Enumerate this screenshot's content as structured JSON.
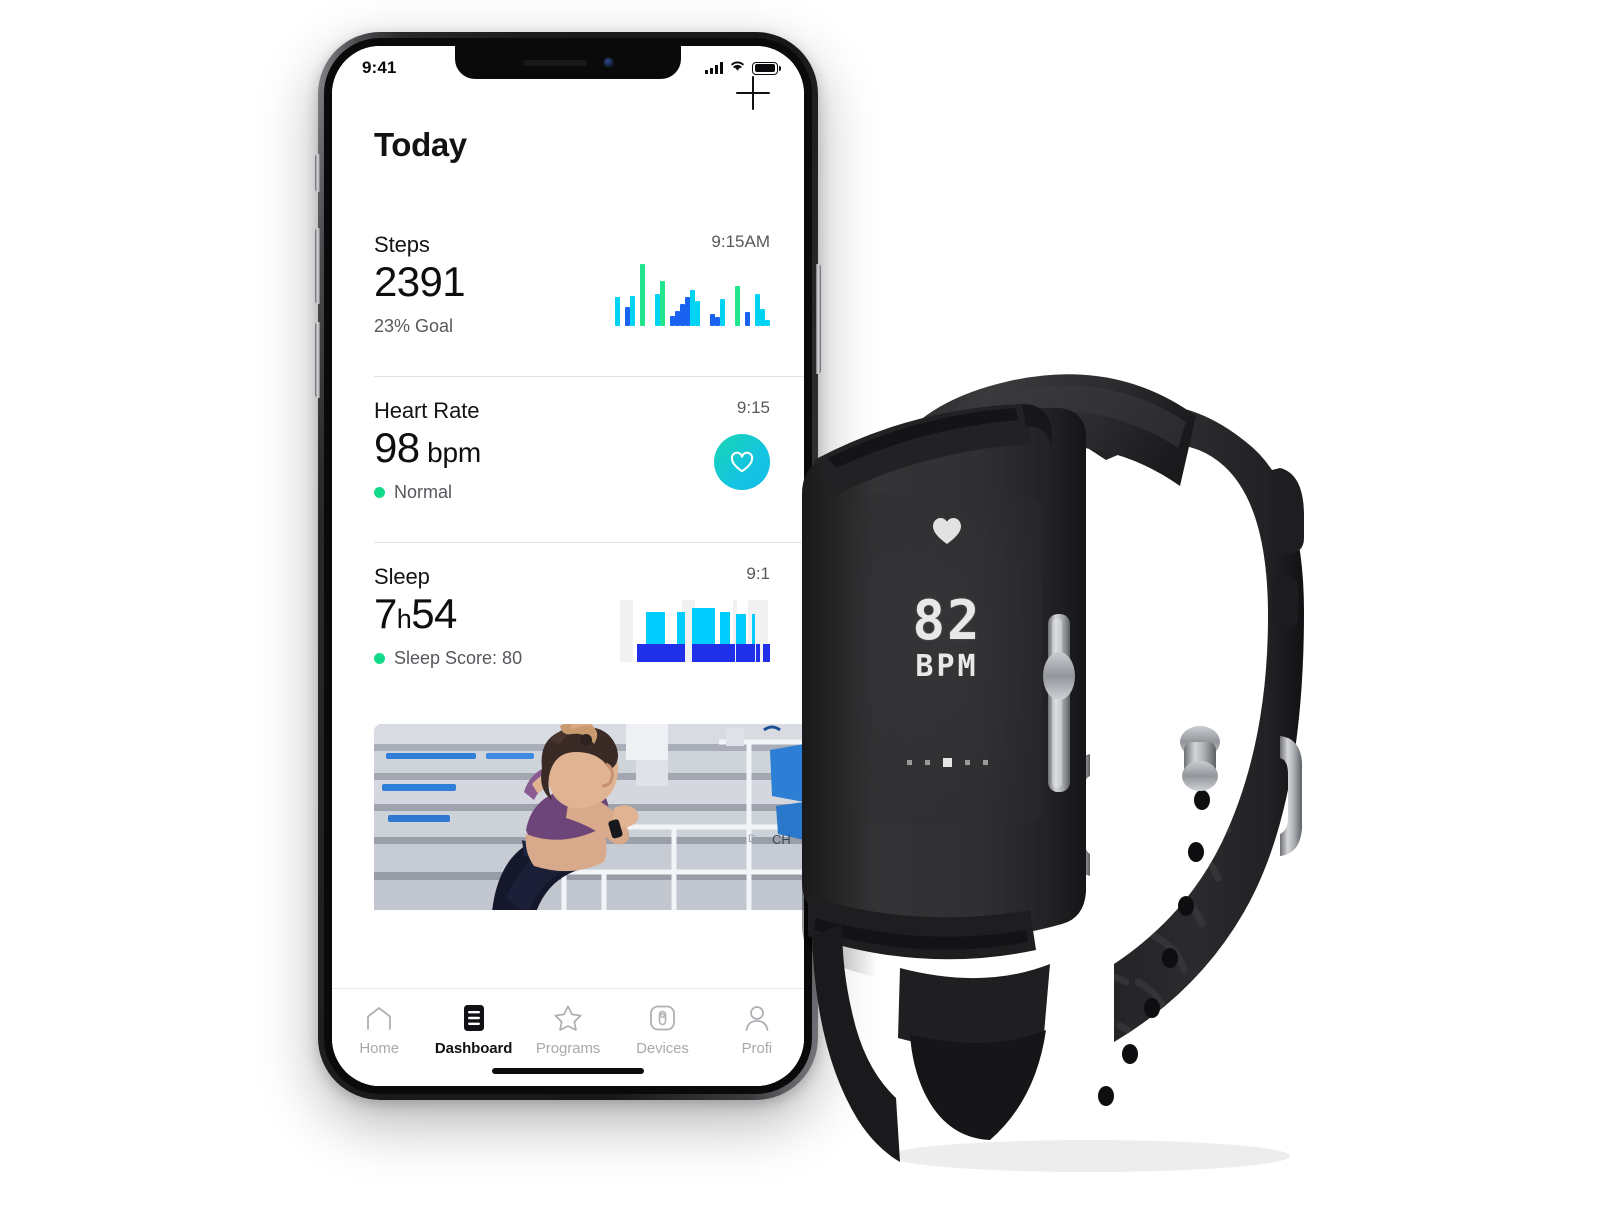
{
  "phone": {
    "status_bar": {
      "time": "9:41",
      "cellular_icon": "signal-bars-icon",
      "wifi_icon": "wifi-icon",
      "battery_icon": "battery-full-icon"
    },
    "app": {
      "add_button": "+",
      "page_title": "Today",
      "rows": [
        {
          "id": "steps",
          "label": "Steps",
          "value": "2391",
          "sub": "23% Goal",
          "time": "9:15AM",
          "has_status_dot": false,
          "visual": "steps-bar-chart"
        },
        {
          "id": "heart-rate",
          "label": "Heart Rate",
          "value": "98",
          "unit": "bpm",
          "sub": "Normal",
          "time": "9:15",
          "has_status_dot": true,
          "visual": "heart-circle-icon"
        },
        {
          "id": "sleep",
          "label": "Sleep",
          "value_hours": "7",
          "value_h_sep": "h",
          "value_minutes": "54",
          "sub": "Sleep Score: 80",
          "time": "9:1",
          "has_status_dot": true,
          "visual": "sleep-bar-chart"
        }
      ],
      "hero_image_alt": "woman stretching on stadium bleachers",
      "tabs": [
        {
          "id": "home",
          "label": "Home",
          "icon": "home-icon",
          "active": false
        },
        {
          "id": "dashboard",
          "label": "Dashboard",
          "icon": "dashboard-icon",
          "active": true
        },
        {
          "id": "programs",
          "label": "Programs",
          "icon": "star-icon",
          "active": false
        },
        {
          "id": "devices",
          "label": "Devices",
          "icon": "watch-icon",
          "active": false
        },
        {
          "id": "profile",
          "label": "Profi",
          "icon": "person-icon",
          "active": false
        }
      ]
    }
  },
  "watch": {
    "heart_icon": "heart-icon",
    "bpm_value": "82",
    "bpm_unit": "BPM",
    "page_dots": 5,
    "page_dot_active_index": 2
  },
  "colors": {
    "steps_green": "#21e58c",
    "steps_cyan": "#00d4f5",
    "steps_blue": "#1a62f0",
    "sleep_cyan": "#00ccff",
    "sleep_blue": "#2030e8",
    "sleep_track": "#f1f1f2",
    "status_green": "#13d98a",
    "hr_gradient_start": "#18d6b0",
    "hr_gradient_end": "#13bbe8",
    "text_primary": "#111214",
    "text_secondary": "#55585c",
    "tab_inactive": "#a7a9ad"
  },
  "chart_data": [
    {
      "type": "bar",
      "id": "steps-bar-chart",
      "title": "Steps",
      "xlabel": "",
      "ylabel": "",
      "grid": false,
      "legend": "none",
      "ylim": [
        0,
        100
      ],
      "colors": [
        "#00d4f5",
        "#1a62f0",
        "#21e58c"
      ],
      "bars": [
        {
          "h": 46,
          "c": "#00d4f5"
        },
        {
          "h": 0,
          "c": "none"
        },
        {
          "h": 30,
          "c": "#1a62f0"
        },
        {
          "h": 48,
          "c": "#00d4f5"
        },
        {
          "h": 0,
          "c": "none"
        },
        {
          "h": 100,
          "c": "#21e58c"
        },
        {
          "h": 0,
          "c": "none"
        },
        {
          "h": 0,
          "c": "none"
        },
        {
          "h": 52,
          "c": "#00d4f5"
        },
        {
          "h": 73,
          "c": "#21e58c"
        },
        {
          "h": 0,
          "c": "none"
        },
        {
          "h": 16,
          "c": "#1a62f0"
        },
        {
          "h": 24,
          "c": "#1a62f0"
        },
        {
          "h": 36,
          "c": "#1a62f0"
        },
        {
          "h": 46,
          "c": "#1a62f0"
        },
        {
          "h": 58,
          "c": "#00d4f5"
        },
        {
          "h": 41,
          "c": "#00d4f5"
        },
        {
          "h": 0,
          "c": "none"
        },
        {
          "h": 0,
          "c": "none"
        },
        {
          "h": 20,
          "c": "#1a62f0"
        },
        {
          "h": 14,
          "c": "#1a62f0"
        },
        {
          "h": 43,
          "c": "#00d4f5"
        },
        {
          "h": 0,
          "c": "none"
        },
        {
          "h": 0,
          "c": "none"
        },
        {
          "h": 64,
          "c": "#21e58c"
        },
        {
          "h": 0,
          "c": "none"
        },
        {
          "h": 23,
          "c": "#1a62f0"
        },
        {
          "h": 0,
          "c": "none"
        },
        {
          "h": 52,
          "c": "#00d4f5"
        },
        {
          "h": 28,
          "c": "#00d4f5"
        },
        {
          "h": 10,
          "c": "#00d4f5"
        }
      ]
    },
    {
      "type": "bar",
      "id": "sleep-bar-chart",
      "title": "Sleep",
      "stacked": true,
      "grid": false,
      "legend": "none",
      "track_color": "#f1f1f2",
      "deep_color": "#2030e8",
      "light_color": "#00ccff",
      "tracks": [
        {
          "x": 0,
          "w": 13
        },
        {
          "x": 62,
          "w": 13
        },
        {
          "x": 113,
          "w": 4
        },
        {
          "x": 128,
          "w": 20
        }
      ],
      "segments": [
        {
          "x": 17,
          "w": 9,
          "light": 0,
          "deep": 18
        },
        {
          "x": 26,
          "w": 19,
          "light": 32,
          "deep": 18
        },
        {
          "x": 45,
          "w": 12,
          "light": 0,
          "deep": 18
        },
        {
          "x": 57,
          "w": 8,
          "light": 32,
          "deep": 18
        },
        {
          "x": 72,
          "w": 23,
          "light": 36,
          "deep": 18
        },
        {
          "x": 95,
          "w": 7,
          "light": 0,
          "deep": 18
        },
        {
          "x": 100,
          "w": 10,
          "light": 32,
          "deep": 18
        },
        {
          "x": 110,
          "w": 5,
          "light": 0,
          "deep": 18
        },
        {
          "x": 116,
          "w": 10,
          "light": 30,
          "deep": 18
        },
        {
          "x": 126,
          "w": 6,
          "light": 0,
          "deep": 18
        },
        {
          "x": 132,
          "w": 3,
          "light": 30,
          "deep": 18
        },
        {
          "x": 136,
          "w": 4,
          "light": 0,
          "deep": 18
        },
        {
          "x": 143,
          "w": 7,
          "light": 0,
          "deep": 18
        }
      ]
    }
  ]
}
